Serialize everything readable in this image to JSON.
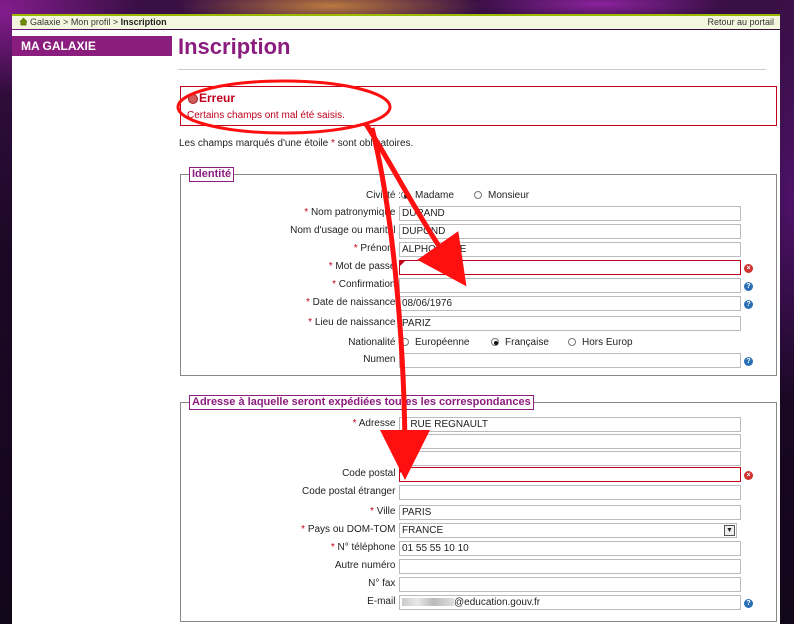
{
  "breadcrumb": {
    "items": [
      "Galaxie",
      "Mon profil"
    ],
    "separator": ">",
    "current": "Inscription",
    "portal_link": "Retour au portail"
  },
  "sidebar": {
    "title": "MA GALAXIE"
  },
  "page_title": "Inscription",
  "error": {
    "title": "Erreur",
    "message": "Certains champs ont mal été saisis."
  },
  "required_note": {
    "before": "Les champs marqués d'une étoile ",
    "star": "*",
    "after": " sont obligatoires."
  },
  "identity": {
    "legend": "Identité",
    "civility": {
      "label": "Civilité :",
      "options": [
        "Madame",
        "Monsieur"
      ],
      "selected": "Madame"
    },
    "last_name": {
      "label": "Nom patronymique :",
      "value": "DURAND",
      "required": true
    },
    "usage_name": {
      "label": "Nom d'usage ou marital :",
      "value": "DUPOND"
    },
    "first_name": {
      "label": "Prénom :",
      "value": "ALPHONSINE",
      "required": true
    },
    "password": {
      "label": "Mot de passe :",
      "value": "",
      "required": true,
      "error": true
    },
    "confirmation": {
      "label": "Confirmation :",
      "value": "",
      "required": true
    },
    "birth_date": {
      "label": "Date de naissance :",
      "value": "08/06/1976",
      "required": true
    },
    "birth_place": {
      "label": "Lieu de naissance :",
      "value": "PARIZ",
      "required": true
    },
    "nationality": {
      "label": "Nationalité :",
      "options": [
        "Européenne",
        "Française",
        "Hors Europ"
      ],
      "selected": "Française"
    },
    "numen": {
      "label": "Numen :",
      "value": ""
    }
  },
  "address": {
    "legend": "Adresse à laquelle seront expédiées toutes les correspondances",
    "street": {
      "label": "Adresse :",
      "value": "2 RUE REGNAULT",
      "required": true
    },
    "street2": {
      "value": ""
    },
    "street3": {
      "value": ""
    },
    "postal_code": {
      "label": "Code postal :",
      "value": "",
      "error": true
    },
    "foreign_postal_code": {
      "label": "Code postal étranger :",
      "value": ""
    },
    "city": {
      "label": "Ville :",
      "value": "PARIS",
      "required": true
    },
    "country": {
      "label": "Pays ou DOM-TOM :",
      "value": "FRANCE",
      "required": true
    },
    "phone": {
      "label": "N° téléphone :",
      "value": "01 55 55 10 10",
      "required": true
    },
    "other_phone": {
      "label": "Autre numéro :",
      "value": ""
    },
    "fax": {
      "label": "N° fax :",
      "value": ""
    },
    "email": {
      "label": "E-mail :",
      "value": "@education.gouv.fr"
    }
  },
  "icons": {
    "info": "info-icon",
    "clear": "clear-field-icon",
    "home": "home-icon",
    "error": "error-icon"
  },
  "colors": {
    "brand": "#8b1d7e",
    "error": "#c0001a",
    "annotation": "#ff0000",
    "topbar_accent": "#9ab800"
  }
}
